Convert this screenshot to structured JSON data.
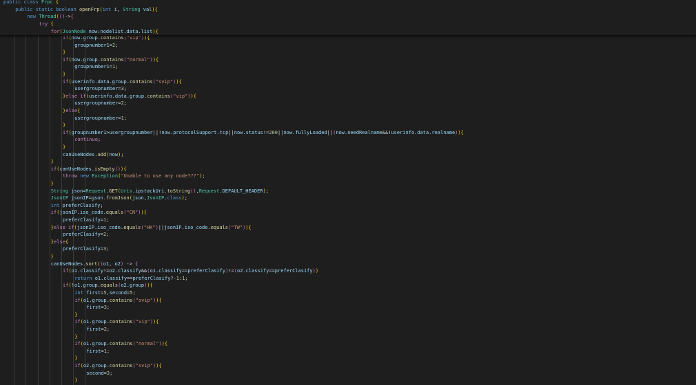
{
  "editor": {
    "colors": {
      "background": "#1e1e1e",
      "keyword": "#569cd6",
      "control": "#c586c0",
      "type": "#4ec9b0",
      "function": "#dcdcaa",
      "string": "#ce9178",
      "number": "#b5cea8",
      "variable": "#9cdcfe",
      "text": "#d4d4d4"
    },
    "lines": [
      {
        "indent": 0,
        "text": "public class Frpc {"
      },
      {
        "indent": 1,
        "text": "public static boolean openFrp(int i, String val){"
      },
      {
        "indent": 2,
        "text": "new Thread(()->{"
      },
      {
        "indent": 3,
        "text": "try {"
      },
      {
        "indent": 4,
        "text": "for(JsonNode now:nodelist.data.list){"
      },
      {
        "indent": 5,
        "text": "if(now.group.contains(\"vip\")){"
      },
      {
        "indent": 6,
        "text": "groupnumber1=2;"
      },
      {
        "indent": 5,
        "text": "}"
      },
      {
        "indent": 5,
        "text": "if(now.group.contains(\"normal\")){"
      },
      {
        "indent": 6,
        "text": "groupnumber1=1;"
      },
      {
        "indent": 5,
        "text": "}"
      },
      {
        "indent": 5,
        "text": "if(userinfo.data.group.contains(\"svip\")){"
      },
      {
        "indent": 6,
        "text": "usergroupnumber=3;"
      },
      {
        "indent": 5,
        "text": "}else if(userinfo.data.group.contains(\"vip\")){"
      },
      {
        "indent": 6,
        "text": "usergroupnumber=2;"
      },
      {
        "indent": 5,
        "text": "}else{"
      },
      {
        "indent": 6,
        "text": "usergroupnumber=1;"
      },
      {
        "indent": 5,
        "text": "}"
      },
      {
        "indent": 5,
        "text": "if(groupnumber1>usergroupnumber||!now.protocolSupport.tcp||now.status!=200||now.fullyLoaded||(now.needRealname&&!userinfo.data.realname)){"
      },
      {
        "indent": 6,
        "text": "continue;"
      },
      {
        "indent": 5,
        "text": "}"
      },
      {
        "indent": 5,
        "text": "canUseNodes.add(now);"
      },
      {
        "indent": 4,
        "text": "}"
      },
      {
        "indent": 4,
        "text": "if(canUseNodes.isEmpty()){"
      },
      {
        "indent": 5,
        "text": "throw new Exception(\"Unable to use any node???\");"
      },
      {
        "indent": 4,
        "text": "}"
      },
      {
        "indent": 4,
        "text": "String json=Request.GET(Uris.ipstackUri.toString(),Request.DEFAULT_HEADER);"
      },
      {
        "indent": 4,
        "text": "JsonIP jsonIP=gson.fromJson(json,JsonIP.class);"
      },
      {
        "indent": 4,
        "text": "int preferClasify;"
      },
      {
        "indent": 4,
        "text": "if(jsonIP.iso_code.equals(\"CN\")){"
      },
      {
        "indent": 5,
        "text": "preferClasify=1;"
      },
      {
        "indent": 4,
        "text": "}else if(jsonIP.iso_code.equals(\"HK\")||jsonIP.iso_code.equals(\"TW\")){"
      },
      {
        "indent": 5,
        "text": "preferClasify=2;"
      },
      {
        "indent": 4,
        "text": "}else{"
      },
      {
        "indent": 5,
        "text": "preferClasify=3;"
      },
      {
        "indent": 4,
        "text": "}"
      },
      {
        "indent": 4,
        "text": "canUseNodes.sort((o1, o2) -> {"
      },
      {
        "indent": 5,
        "text": "if(o1.classify!=o2.classify&&(o1.classify==preferClasify)!=(o2.classify==preferClasify))"
      },
      {
        "indent": 6,
        "text": "return o1.classify==preferClasify?-1:1;"
      },
      {
        "indent": 5,
        "text": "if(!o1.group.equals(o2.group)){"
      },
      {
        "indent": 6,
        "text": "int first=5,second=5;"
      },
      {
        "indent": 6,
        "text": "if(o1.group.contains(\"svip\")){"
      },
      {
        "indent": 7,
        "text": "first=3;"
      },
      {
        "indent": 6,
        "text": "}"
      },
      {
        "indent": 6,
        "text": "if(o1.group.contains(\"vip\")){"
      },
      {
        "indent": 7,
        "text": "first=2;"
      },
      {
        "indent": 6,
        "text": "}"
      },
      {
        "indent": 6,
        "text": "if(o1.group.contains(\"normal\")){"
      },
      {
        "indent": 7,
        "text": "first=1;"
      },
      {
        "indent": 6,
        "text": "}"
      },
      {
        "indent": 6,
        "text": "if(o2.group.contains(\"svip\")){"
      },
      {
        "indent": 7,
        "text": "second=3;"
      },
      {
        "indent": 6,
        "text": "}"
      }
    ]
  }
}
